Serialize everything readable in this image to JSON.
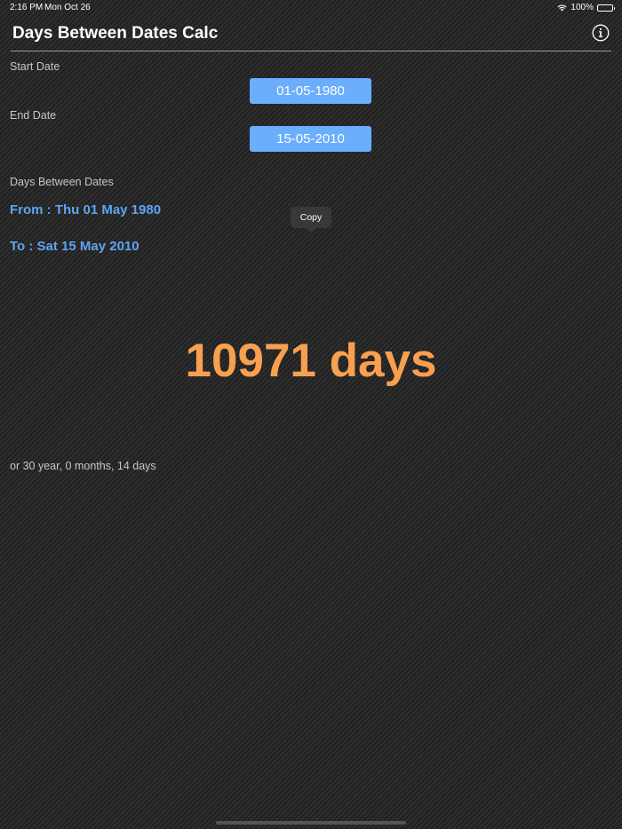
{
  "status_bar": {
    "time": "2:16 PM",
    "date": "Mon Oct 26",
    "battery": "100%",
    "battery_level": 1.0,
    "wifi_icon": "wifi-icon"
  },
  "nav": {
    "title": "Days Between Dates Calc",
    "info_icon": "info-icon"
  },
  "start_date": {
    "label": "Start Date",
    "value": "01-05-1980"
  },
  "end_date": {
    "label": "End Date",
    "value": "15-05-2010"
  },
  "result": {
    "label": "Days Between Dates",
    "from_text": "From : Thu 01 May 1980",
    "to_text": "To : Sat 15 May 2010",
    "days_text": "10971 days",
    "detail_text": "or 30 year, 0 months, 14 days"
  },
  "popup": {
    "copy_label": "Copy"
  },
  "colors": {
    "accent_blue": "#6aaefc",
    "link_blue": "#5fa4f2",
    "result_orange": "#f7a050"
  }
}
